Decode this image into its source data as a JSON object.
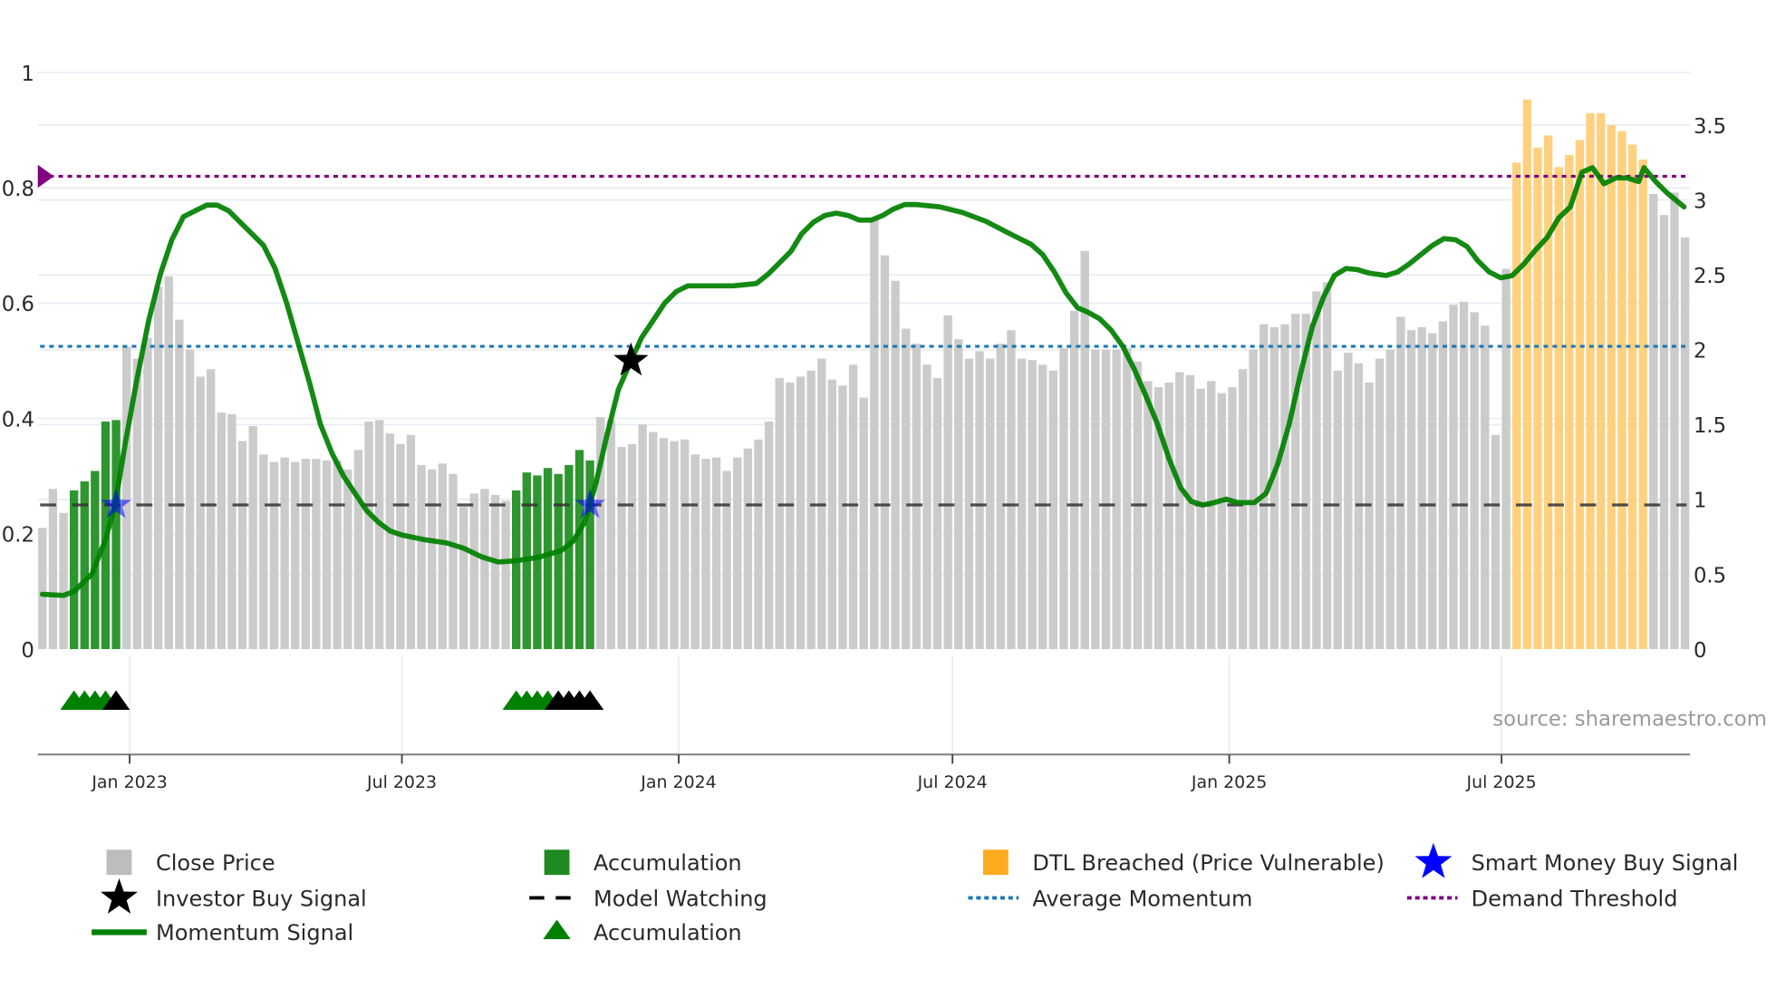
{
  "chart_data": {
    "type": "bar",
    "title": "",
    "source_label": "source: sharemaestro.com",
    "x_start_date": "2022-11-04",
    "x_step_days": 7,
    "x_ticks": [
      {
        "date": "2023-01-01",
        "label": "Jan 2023"
      },
      {
        "date": "2023-07-01",
        "label": "Jul 2023"
      },
      {
        "date": "2024-01-01",
        "label": "Jan 2024"
      },
      {
        "date": "2024-07-01",
        "label": "Jul 2024"
      },
      {
        "date": "2025-01-01",
        "label": "Jan 2025"
      },
      {
        "date": "2025-07-01",
        "label": "Jul 2025"
      }
    ],
    "left_axis": {
      "range": [
        0,
        1
      ],
      "ticks": [
        "0",
        "0.2",
        "0.4",
        "0.6",
        "0.8",
        "1"
      ],
      "tick_values": [
        0,
        0.2,
        0.4,
        0.6,
        0.8,
        1
      ]
    },
    "right_axis": {
      "range": [
        0,
        3.85
      ],
      "ticks": [
        "0",
        "0.5",
        "1",
        "1.5",
        "2",
        "2.5",
        "3",
        "3.5"
      ],
      "tick_values": [
        0,
        0.5,
        1,
        1.5,
        2,
        2.5,
        3,
        3.5
      ]
    },
    "close_price": [
      0.81,
      1.07,
      0.91,
      1.06,
      1.12,
      1.19,
      1.52,
      1.53,
      2.02,
      1.94,
      2.08,
      2.42,
      2.49,
      2.2,
      2.0,
      1.82,
      1.87,
      1.58,
      1.57,
      1.39,
      1.49,
      1.3,
      1.25,
      1.28,
      1.25,
      1.27,
      1.27,
      1.26,
      1.26,
      1.2,
      1.33,
      1.52,
      1.53,
      1.44,
      1.37,
      1.43,
      1.23,
      1.2,
      1.24,
      1.17,
      0.95,
      1.04,
      1.07,
      1.03,
      0.99,
      1.06,
      1.18,
      1.16,
      1.21,
      1.17,
      1.23,
      1.33,
      1.26,
      1.55,
      1.53,
      1.35,
      1.37,
      1.5,
      1.45,
      1.41,
      1.39,
      1.4,
      1.3,
      1.27,
      1.28,
      1.19,
      1.28,
      1.34,
      1.4,
      1.52,
      1.81,
      1.78,
      1.82,
      1.86,
      1.94,
      1.8,
      1.76,
      1.9,
      1.68,
      2.88,
      2.63,
      2.46,
      2.14,
      2.04,
      1.9,
      1.81,
      2.23,
      2.07,
      1.94,
      1.99,
      1.94,
      2.04,
      2.13,
      1.94,
      1.93,
      1.9,
      1.86,
      2.01,
      2.26,
      2.66,
      2.0,
      2.0,
      2.0,
      2.01,
      1.92,
      1.79,
      1.75,
      1.78,
      1.85,
      1.83,
      1.74,
      1.79,
      1.71,
      1.75,
      1.87,
      2.0,
      2.17,
      2.15,
      2.17,
      2.24,
      2.24,
      2.39,
      2.45,
      1.86,
      1.98,
      1.91,
      1.78,
      1.94,
      2.0,
      2.22,
      2.13,
      2.15,
      2.11,
      2.19,
      2.3,
      2.32,
      2.25,
      2.16,
      1.43,
      2.54,
      3.25,
      3.67,
      3.35,
      3.43,
      3.22,
      3.3,
      3.4,
      3.58,
      3.58,
      3.5,
      3.46,
      3.37,
      3.27,
      3.04,
      2.9,
      3.05,
      2.75
    ],
    "accumulation_bar_indices": [
      3,
      4,
      5,
      6,
      7,
      45,
      46,
      47,
      48,
      49,
      50,
      51,
      52
    ],
    "dtl_breached_bar_indices": [
      140,
      141,
      142,
      143,
      144,
      145,
      146,
      147,
      148,
      149,
      150,
      151,
      152
    ],
    "momentum_signal": [
      [
        0,
        0.095
      ],
      [
        2,
        0.093
      ],
      [
        3,
        0.1
      ],
      [
        4.7,
        0.13
      ],
      [
        6,
        0.19
      ],
      [
        6.9,
        0.25
      ],
      [
        7.9,
        0.36
      ],
      [
        9,
        0.47
      ],
      [
        10.1,
        0.57
      ],
      [
        11.2,
        0.65
      ],
      [
        12.3,
        0.71
      ],
      [
        13.4,
        0.75
      ],
      [
        14.5,
        0.76
      ],
      [
        15.6,
        0.77
      ],
      [
        16.6,
        0.77
      ],
      [
        17.7,
        0.76
      ],
      [
        18.8,
        0.74
      ],
      [
        19.9,
        0.72
      ],
      [
        21,
        0.7
      ],
      [
        22.1,
        0.66
      ],
      [
        23.2,
        0.6
      ],
      [
        24.3,
        0.53
      ],
      [
        25.4,
        0.46
      ],
      [
        26.4,
        0.39
      ],
      [
        27.5,
        0.34
      ],
      [
        28.6,
        0.3
      ],
      [
        29.7,
        0.27
      ],
      [
        30.8,
        0.24
      ],
      [
        31.9,
        0.22
      ],
      [
        33,
        0.205
      ],
      [
        34.1,
        0.198
      ],
      [
        36.2,
        0.19
      ],
      [
        38.4,
        0.184
      ],
      [
        40,
        0.175
      ],
      [
        41.7,
        0.16
      ],
      [
        43.3,
        0.151
      ],
      [
        44.9,
        0.153
      ],
      [
        47.1,
        0.159
      ],
      [
        49.3,
        0.171
      ],
      [
        50.4,
        0.187
      ],
      [
        51.5,
        0.22
      ],
      [
        52.6,
        0.29
      ],
      [
        53.6,
        0.37
      ],
      [
        54.7,
        0.45
      ],
      [
        55.9,
        0.5
      ],
      [
        56.9,
        0.54
      ],
      [
        58,
        0.57
      ],
      [
        59.1,
        0.6
      ],
      [
        60.2,
        0.62
      ],
      [
        61.3,
        0.63
      ],
      [
        63.4,
        0.63
      ],
      [
        65.6,
        0.63
      ],
      [
        67.8,
        0.634
      ],
      [
        68.9,
        0.65
      ],
      [
        70,
        0.67
      ],
      [
        71.1,
        0.69
      ],
      [
        72.1,
        0.72
      ],
      [
        73.2,
        0.74
      ],
      [
        74.3,
        0.752
      ],
      [
        75.4,
        0.756
      ],
      [
        76.5,
        0.752
      ],
      [
        77.6,
        0.744
      ],
      [
        78.7,
        0.744
      ],
      [
        79.8,
        0.752
      ],
      [
        80.8,
        0.763
      ],
      [
        81.9,
        0.771
      ],
      [
        83,
        0.771
      ],
      [
        85.2,
        0.767
      ],
      [
        87.4,
        0.757
      ],
      [
        89.6,
        0.742
      ],
      [
        91.7,
        0.722
      ],
      [
        93.9,
        0.702
      ],
      [
        95,
        0.684
      ],
      [
        96.1,
        0.654
      ],
      [
        97.2,
        0.618
      ],
      [
        98.3,
        0.592
      ],
      [
        99.3,
        0.584
      ],
      [
        100.4,
        0.573
      ],
      [
        101.5,
        0.553
      ],
      [
        102.6,
        0.525
      ],
      [
        103.7,
        0.485
      ],
      [
        104.8,
        0.439
      ],
      [
        105.9,
        0.39
      ],
      [
        107,
        0.33
      ],
      [
        108.1,
        0.28
      ],
      [
        109.1,
        0.256
      ],
      [
        110.2,
        0.25
      ],
      [
        111.3,
        0.254
      ],
      [
        112.4,
        0.26
      ],
      [
        113.5,
        0.254
      ],
      [
        115.1,
        0.254
      ],
      [
        116.2,
        0.27
      ],
      [
        117.3,
        0.32
      ],
      [
        118.4,
        0.39
      ],
      [
        119.5,
        0.479
      ],
      [
        120.6,
        0.559
      ],
      [
        121.7,
        0.612
      ],
      [
        122.7,
        0.648
      ],
      [
        123.8,
        0.66
      ],
      [
        124.9,
        0.658
      ],
      [
        126,
        0.652
      ],
      [
        127.6,
        0.648
      ],
      [
        128.7,
        0.654
      ],
      [
        129.8,
        0.668
      ],
      [
        130.9,
        0.684
      ],
      [
        132,
        0.7
      ],
      [
        133.1,
        0.712
      ],
      [
        134.2,
        0.71
      ],
      [
        135.3,
        0.698
      ],
      [
        136.3,
        0.674
      ],
      [
        137.4,
        0.654
      ],
      [
        138.5,
        0.644
      ],
      [
        139.6,
        0.648
      ],
      [
        140.7,
        0.668
      ],
      [
        141.8,
        0.692
      ],
      [
        142.9,
        0.714
      ],
      [
        144,
        0.748
      ],
      [
        145.1,
        0.767
      ],
      [
        146.2,
        0.827
      ],
      [
        147.2,
        0.835
      ],
      [
        148.3,
        0.807
      ],
      [
        149.4,
        0.817
      ],
      [
        150.5,
        0.817
      ],
      [
        151.6,
        0.811
      ],
      [
        152.1,
        0.835
      ],
      [
        153.2,
        0.811
      ],
      [
        154.3,
        0.791
      ],
      [
        155.9,
        0.767
      ]
    ],
    "average_momentum": 0.525,
    "demand_threshold": 0.82,
    "model_watching": 0.25,
    "smart_money_buy_signals": [
      [
        7,
        0.25
      ],
      [
        52,
        0.25
      ]
    ],
    "investor_buy_signals": [
      [
        55.9,
        0.5
      ]
    ],
    "accumulation_triangles_green": [
      3,
      4,
      5,
      6,
      45,
      46,
      47,
      48
    ],
    "accumulation_triangles_black": [
      7,
      49,
      50,
      51,
      52
    ],
    "legend": [
      {
        "label": "Close Price",
        "color": "#bdbdbd"
      },
      {
        "label": "Accumulation",
        "color": "#1f8a1f"
      },
      {
        "label": "DTL Breached (Price Vulnerable)",
        "color": "#ffab1f"
      },
      {
        "label": "Smart Money Buy Signal",
        "color": "#0000ff"
      },
      {
        "label": "Investor Buy Signal",
        "color": "#000000"
      },
      {
        "label": "Model Watching",
        "color": "#000000"
      },
      {
        "label": "Average Momentum",
        "color": "#1f77b4"
      },
      {
        "label": "Demand Threshold",
        "color": "#800080"
      },
      {
        "label": "Momentum Signal",
        "color": "#008000"
      },
      {
        "label": "Accumulation",
        "color": "#008000"
      }
    ],
    "legend_placement": "bottom",
    "colors": {
      "bar_gray": "#cbcbcb",
      "bar_green": "#2e962e",
      "bar_orange": "#ffd17f",
      "momentum": "#008000",
      "avg": "#1f77b4",
      "threshold": "#800080"
    }
  }
}
